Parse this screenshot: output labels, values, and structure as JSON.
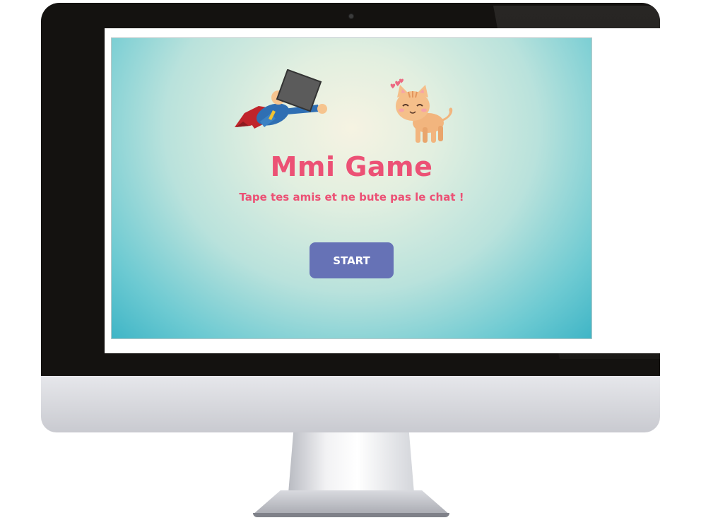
{
  "game": {
    "title": "Mmi Game",
    "subtitle": "Tape tes amis et ne bute pas le chat !",
    "start_label": "START"
  },
  "colors": {
    "title": "#ec5175",
    "button": "#6672b6",
    "background_center": "#f6f3e2",
    "background_edge": "#3fb5c6"
  },
  "icons": {
    "hero": "flying-hero-icon",
    "box": "box-icon",
    "cat": "cat-icon",
    "hearts": "hearts-icon"
  }
}
